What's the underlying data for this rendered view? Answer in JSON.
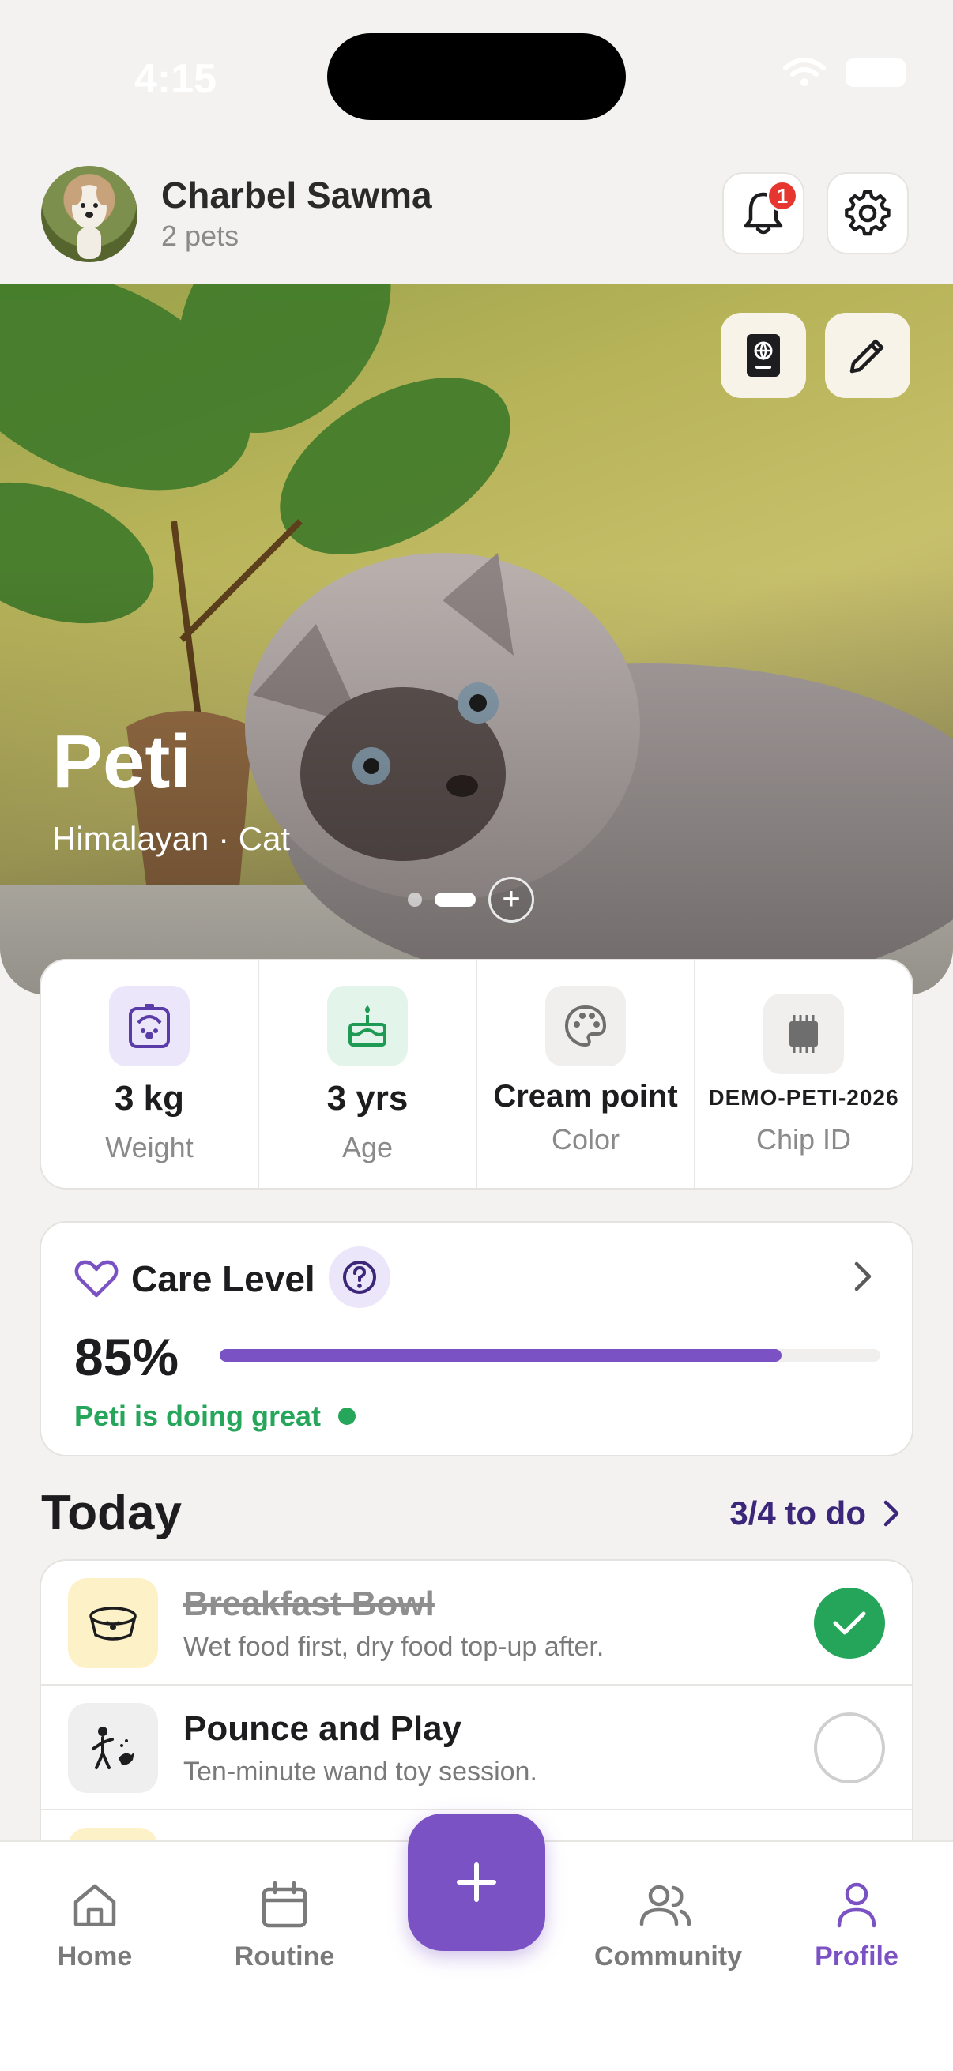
{
  "status_bar": {
    "time": "4:15"
  },
  "header": {
    "user_name": "Charbel Sawma",
    "pets_count": "2 pets",
    "notification_count": "1"
  },
  "hero": {
    "pet_name": "Peti",
    "breed_line": "Himalayan · Cat",
    "add_photo_glyph": "+"
  },
  "stats": [
    {
      "value": "3 kg",
      "label": "Weight",
      "icon": "weight-scale-paw-icon"
    },
    {
      "value": "3 yrs",
      "label": "Age",
      "icon": "birthday-cake-icon"
    },
    {
      "value": "Cream point",
      "label": "Color",
      "icon": "palette-icon"
    },
    {
      "value": "DEMO-PETI-2026",
      "label": "Chip ID",
      "icon": "microchip-icon"
    }
  ],
  "care": {
    "title": "Care Level",
    "percent_text": "85%",
    "percent_value": 0.85,
    "status": "Peti is doing great",
    "accent_color": "#7b52c4",
    "status_color": "#26a65b"
  },
  "today": {
    "title": "Today",
    "todo_link": "3/4 to do",
    "tasks": [
      {
        "title": "Breakfast Bowl",
        "desc": "Wet food first, dry food top-up after.",
        "done": true,
        "icon": "food-bowl-icon"
      },
      {
        "title": "Pounce and Play",
        "desc": "Ten-minute wand toy session.",
        "done": false,
        "icon": "play-with-pet-icon"
      }
    ]
  },
  "tabs": [
    {
      "label": "Home",
      "icon": "home-icon"
    },
    {
      "label": "Routine",
      "icon": "calendar-icon"
    },
    {
      "label": "Community",
      "icon": "community-icon"
    },
    {
      "label": "Profile",
      "icon": "profile-icon",
      "active": true
    }
  ],
  "fab_glyph": "+"
}
